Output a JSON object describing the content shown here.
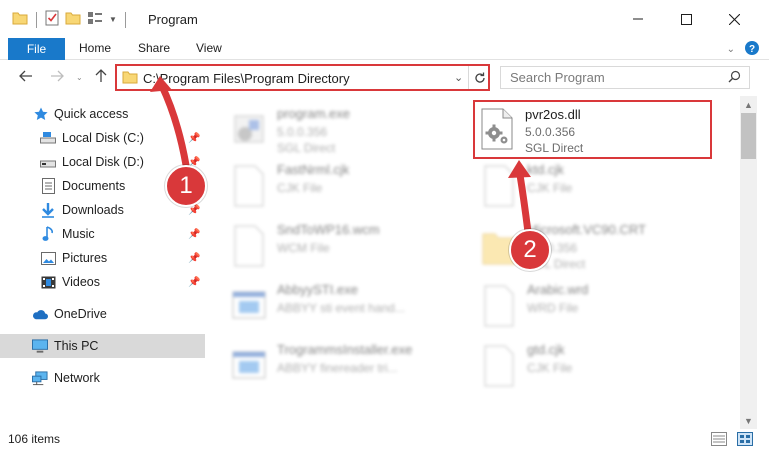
{
  "window": {
    "title": "Program"
  },
  "ribbon": {
    "file": "File",
    "tabs": [
      "Home",
      "Share",
      "View"
    ]
  },
  "address": {
    "path": "C:\\Program Files\\Program Directory"
  },
  "search": {
    "placeholder": "Search Program"
  },
  "sidebar": {
    "items": [
      {
        "label": "Quick access",
        "icon": "star-icon"
      },
      {
        "label": "Local Disk (C:)",
        "icon": "drive-icon"
      },
      {
        "label": "Local Disk (D:)",
        "icon": "drive-icon"
      },
      {
        "label": "Documents",
        "icon": "documents-icon"
      },
      {
        "label": "Downloads",
        "icon": "download-icon"
      },
      {
        "label": "Music",
        "icon": "music-icon"
      },
      {
        "label": "Pictures",
        "icon": "pictures-icon"
      },
      {
        "label": "Videos",
        "icon": "videos-icon"
      },
      {
        "label": "OneDrive",
        "icon": "cloud-icon"
      },
      {
        "label": "This PC",
        "icon": "computer-icon"
      },
      {
        "label": "Network",
        "icon": "network-icon"
      }
    ]
  },
  "files": [
    {
      "name": "program.exe",
      "line2": "5.0.0.356",
      "line3": "SGL Direct"
    },
    {
      "name": "pvr2os.dll",
      "line2": "5.0.0.356",
      "line3": "SGL Direct"
    },
    {
      "name": "FastNrml.cjk",
      "line2": "CJK File",
      "line3": ""
    },
    {
      "name": "ktd.cjk",
      "line2": "CJK File",
      "line3": ""
    },
    {
      "name": "SndToWP16.wcm",
      "line2": "WCM File",
      "line3": ""
    },
    {
      "name": "Microsoft.VC90.CRT",
      "line2": "5.0.0.356",
      "line3": "SGL Direct"
    },
    {
      "name": "AbbyySTI.exe",
      "line2": "ABBYY sti event hand...",
      "line3": ""
    },
    {
      "name": "Arabic.wrd",
      "line2": "WRD File",
      "line3": ""
    },
    {
      "name": "TrogrammsInstaller.exe",
      "line2": "ABBYY finereader tri...",
      "line3": ""
    },
    {
      "name": "gtd.cjk",
      "line2": "CJK File",
      "line3": ""
    }
  ],
  "status": {
    "items": "106 items"
  },
  "annotations": [
    "1",
    "2"
  ],
  "colors": {
    "accent": "#1979ca",
    "highlight": "#d9383a"
  }
}
